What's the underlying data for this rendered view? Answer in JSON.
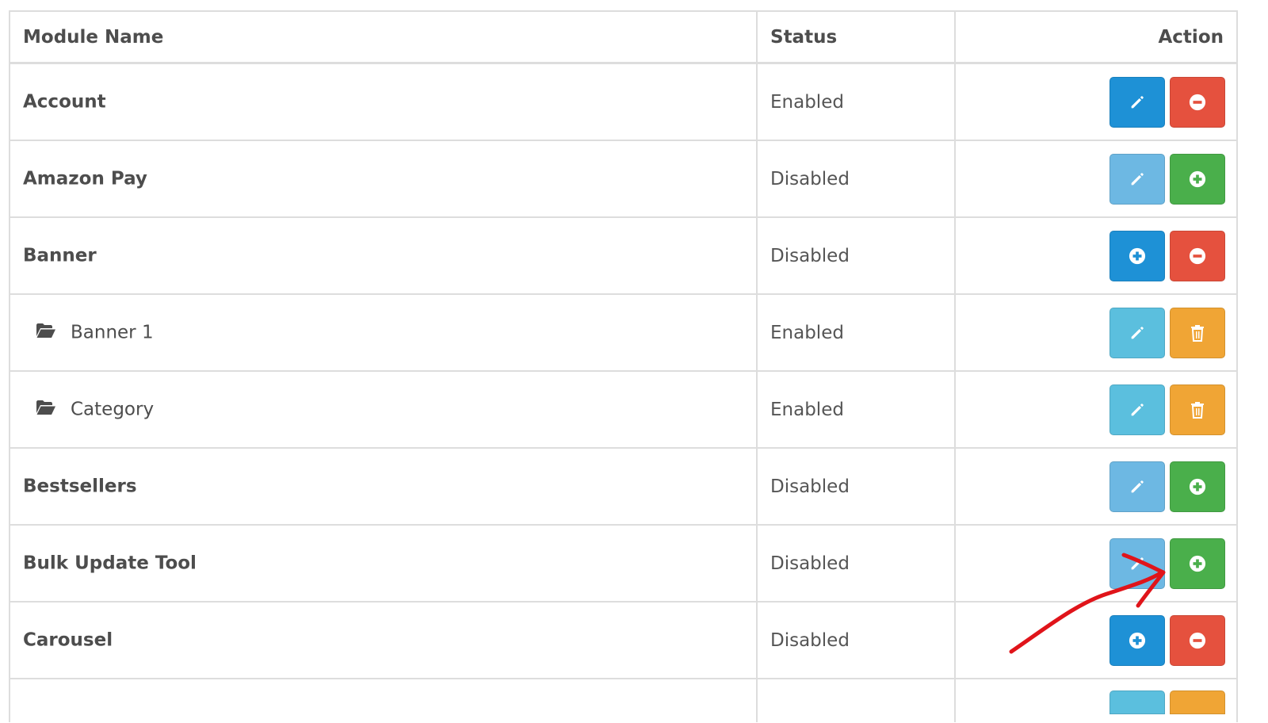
{
  "table": {
    "headers": {
      "name": "Module Name",
      "status": "Status",
      "action": "Action"
    },
    "rows": [
      {
        "name": "Account",
        "status": "Enabled",
        "child": false,
        "buttons": [
          {
            "icon": "pencil-icon",
            "color": "#1e91d6",
            "action": "edit"
          },
          {
            "icon": "minus-circle-icon",
            "color": "#e5513e",
            "action": "uninstall"
          }
        ]
      },
      {
        "name": "Amazon Pay",
        "status": "Disabled",
        "child": false,
        "buttons": [
          {
            "icon": "pencil-icon",
            "color": "#6db8e3",
            "action": "edit"
          },
          {
            "icon": "plus-circle-icon",
            "color": "#4aaf4b",
            "action": "install"
          }
        ]
      },
      {
        "name": "Banner",
        "status": "Disabled",
        "child": false,
        "buttons": [
          {
            "icon": "plus-circle-icon",
            "color": "#1e91d6",
            "action": "add"
          },
          {
            "icon": "minus-circle-icon",
            "color": "#e5513e",
            "action": "uninstall"
          }
        ]
      },
      {
        "name": "Banner 1",
        "status": "Enabled",
        "child": true,
        "buttons": [
          {
            "icon": "pencil-icon",
            "color": "#5bbfde",
            "action": "edit"
          },
          {
            "icon": "trash-icon",
            "color": "#f0a535",
            "action": "delete"
          }
        ]
      },
      {
        "name": "Category",
        "status": "Enabled",
        "child": true,
        "buttons": [
          {
            "icon": "pencil-icon",
            "color": "#5bbfde",
            "action": "edit"
          },
          {
            "icon": "trash-icon",
            "color": "#f0a535",
            "action": "delete"
          }
        ]
      },
      {
        "name": "Bestsellers",
        "status": "Disabled",
        "child": false,
        "buttons": [
          {
            "icon": "pencil-icon",
            "color": "#6db8e3",
            "action": "edit"
          },
          {
            "icon": "plus-circle-icon",
            "color": "#4aaf4b",
            "action": "install"
          }
        ]
      },
      {
        "name": "Bulk Update Tool",
        "status": "Disabled",
        "child": false,
        "buttons": [
          {
            "icon": "pencil-icon",
            "color": "#6db8e3",
            "action": "edit"
          },
          {
            "icon": "plus-circle-icon",
            "color": "#4aaf4b",
            "action": "install"
          }
        ]
      },
      {
        "name": "Carousel",
        "status": "Disabled",
        "child": false,
        "buttons": [
          {
            "icon": "plus-circle-icon",
            "color": "#1e91d6",
            "action": "add"
          },
          {
            "icon": "minus-circle-icon",
            "color": "#e5513e",
            "action": "uninstall"
          }
        ]
      }
    ],
    "partial_row_buttons": [
      {
        "icon": "pencil-icon",
        "color": "#5bbfde"
      },
      {
        "icon": "trash-icon",
        "color": "#f0a535"
      }
    ]
  },
  "annotation": {
    "type": "hand-drawn-arrow",
    "color": "#e0141a",
    "points_to": "Bulk Update Tool install button"
  }
}
